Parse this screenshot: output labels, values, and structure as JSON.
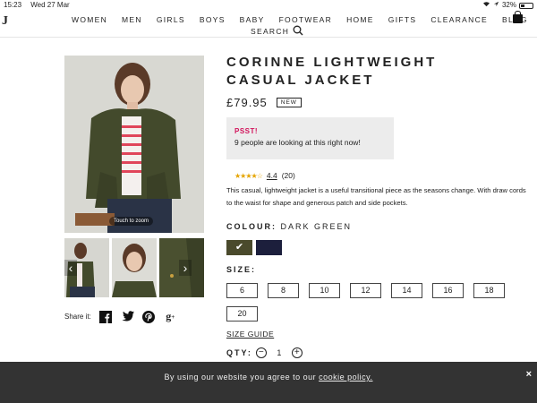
{
  "status_bar": {
    "time": "15:23",
    "date": "Wed 27 Mar",
    "battery": "32%",
    "battery_level": 0.32
  },
  "nav": {
    "logo": "J",
    "items": [
      "WOMEN",
      "MEN",
      "GIRLS",
      "BOYS",
      "BABY",
      "FOOTWEAR",
      "HOME",
      "GIFTS",
      "CLEARANCE",
      "BLOG"
    ],
    "search_label": "SEARCH"
  },
  "gallery": {
    "zoom_hint": "Touch to zoom",
    "share_label": "Share it:"
  },
  "product": {
    "title": "CORINNE LIGHTWEIGHT CASUAL JACKET",
    "price": "£79.95",
    "badge": "NEW",
    "psst_heading": "PSST!",
    "psst_text": "9 people are looking at this right now!",
    "rating_score": "4.4",
    "rating_value": 4.4,
    "rating_count": "(20)",
    "description": "This casual, lightweight jacket is a useful transitional piece as the seasons change. With draw cords to the waist for shape and generous patch and side pockets.",
    "colour_label": "COLOUR:",
    "colour_value": "DARK GREEN",
    "swatches": [
      {
        "name": "Dark Green",
        "color": "#4a4a2c",
        "selected": true
      },
      {
        "name": "Navy",
        "color": "#1c1f3c",
        "selected": false
      }
    ],
    "size_label": "SIZE:",
    "sizes": [
      "6",
      "8",
      "10",
      "12",
      "14",
      "16",
      "18",
      "20"
    ],
    "size_guide": "SIZE GUIDE",
    "qty_label": "QTY:",
    "qty_value": "1"
  },
  "cookie_bar": {
    "message": "By using our website you agree to our",
    "link": "cookie policy.",
    "close": "×"
  }
}
